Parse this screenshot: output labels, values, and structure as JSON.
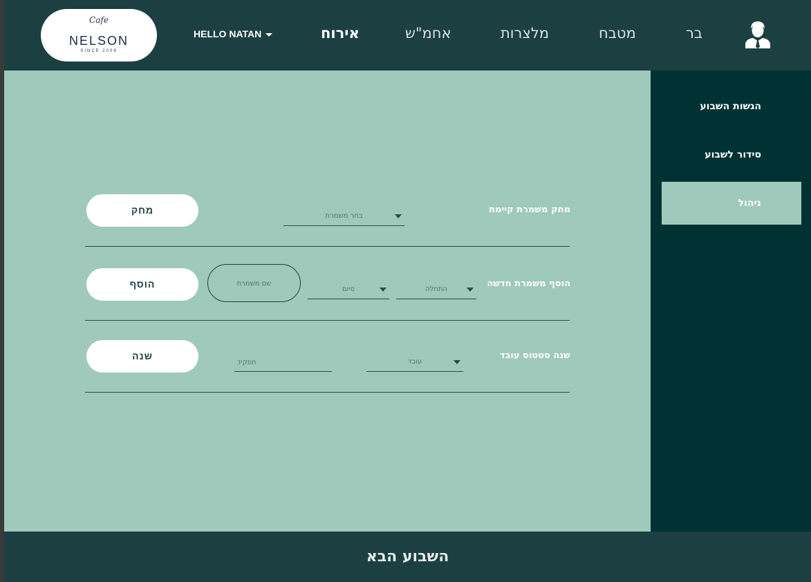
{
  "header": {
    "logo": {
      "cafe": "Cafe",
      "name": "NELSON",
      "since": "SINCE 2009"
    },
    "hello": "HELLO NATAN",
    "nav": [
      {
        "label": "אירוח",
        "active": true
      },
      {
        "label": "אחמ\"ש",
        "active": false
      },
      {
        "label": "מלצרות",
        "active": false
      },
      {
        "label": "מטבח",
        "active": false
      },
      {
        "label": "בר",
        "active": false
      }
    ],
    "user_icon": "user-avatar-icon"
  },
  "sidebar": {
    "items": [
      {
        "label": "הגשות השבוע",
        "active": false
      },
      {
        "label": "סידור לשבוע",
        "active": false
      },
      {
        "label": "ניהול",
        "active": true
      }
    ]
  },
  "main": {
    "delete_shift": {
      "label": "מחק משמרת קיימת",
      "select_placeholder": "בחר משמרת",
      "button": "מחק"
    },
    "add_shift": {
      "label": "הוסף משמרת חדשה",
      "start_placeholder": "התחלה",
      "end_placeholder": "סיום",
      "name_placeholder": "שם משמרת",
      "button": "הוסף"
    },
    "change_status": {
      "label": "שנה סטטוס עובד",
      "employee_placeholder": "עובד",
      "role_placeholder": "תפקיד",
      "button": "שנה"
    }
  },
  "footer": {
    "label": "השבוע הבא"
  },
  "colors": {
    "header_bg": "#1c3f42",
    "main_bg": "#9fc9ba",
    "sidebar_bg": "#003234",
    "button_bg": "#ffffff"
  }
}
